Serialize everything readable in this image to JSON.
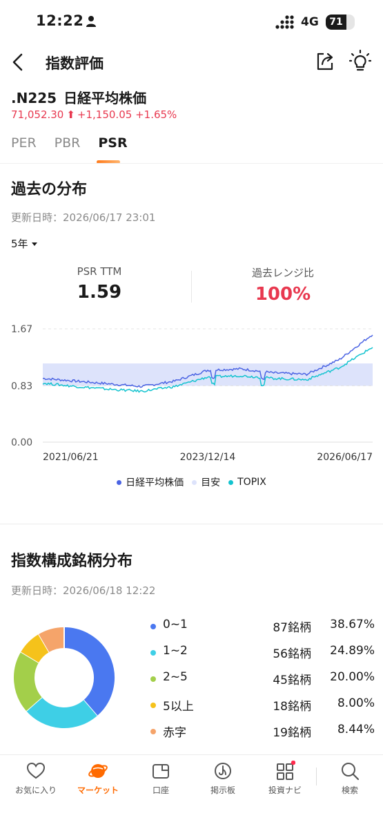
{
  "status_bar": {
    "time": "12:22",
    "network": "4G",
    "battery": "71",
    "battery_level": 0.71
  },
  "header": {
    "title": "指数評価"
  },
  "ticker": {
    "code": ".N225",
    "name": "日経平均株価",
    "price": "71,052.30",
    "change": "+1,150.05",
    "change_pct": "+1.65%",
    "color_up": "#e8384f"
  },
  "tabs": [
    {
      "label": "PER",
      "active": false
    },
    {
      "label": "PBR",
      "active": false
    },
    {
      "label": "PSR",
      "active": true
    }
  ],
  "history": {
    "title": "過去の分布",
    "updated": "更新日時：2026/06/17 23:01",
    "period": "5年",
    "kpi_left": {
      "label": "PSR TTM",
      "value": "1.59"
    },
    "kpi_right": {
      "label": "過去レンジ比",
      "value": "100%",
      "color": "#e8384f"
    }
  },
  "chart_data": {
    "type": "line",
    "x_ticks": [
      "2021/06/21",
      "2023/12/14",
      "2026/06/17"
    ],
    "y_ticks": [
      "1.67",
      "0.83",
      "0.00"
    ],
    "ylim": [
      0,
      1.67
    ],
    "band": [
      0.83,
      1.16
    ],
    "x": [
      "2021/06",
      "2021/12",
      "2022/06",
      "2022/12",
      "2023/06",
      "2023/12",
      "2024/06",
      "2024/12",
      "2025/06",
      "2025/12",
      "2026/06"
    ],
    "series": [
      {
        "name": "日経平均株価",
        "color": "#4a63e3",
        "values": [
          0.94,
          0.9,
          0.86,
          0.82,
          0.9,
          1.06,
          1.08,
          1.02,
          1.0,
          1.22,
          1.59
        ]
      },
      {
        "name": "TOPIX",
        "color": "#12c3cf",
        "values": [
          0.87,
          0.82,
          0.78,
          0.75,
          0.82,
          0.96,
          0.98,
          0.94,
          0.92,
          1.1,
          1.4
        ]
      }
    ],
    "legend": [
      {
        "name": "日経平均株価",
        "color": "#4a63e3"
      },
      {
        "name": "目安",
        "color": "#dde3fb"
      },
      {
        "name": "TOPIX",
        "color": "#12c3cf"
      }
    ],
    "legend_position": "bottom",
    "grid": true
  },
  "constituents": {
    "title": "指数構成銘柄分布",
    "updated": "更新日時：2026/06/18 12:22",
    "rows": [
      {
        "label": "0~1",
        "count": "87銘柄",
        "pct": "38.67%",
        "value": 38.67,
        "color": "#4a78f0"
      },
      {
        "label": "1~2",
        "count": "56銘柄",
        "pct": "24.89%",
        "value": 24.89,
        "color": "#3ecfe6"
      },
      {
        "label": "2~5",
        "count": "45銘柄",
        "pct": "20.00%",
        "value": 20.0,
        "color": "#a3cf4a"
      },
      {
        "label": "5以上",
        "count": "18銘柄",
        "pct": "8.00%",
        "value": 8.0,
        "color": "#f5c21b"
      },
      {
        "label": "赤字",
        "count": "19銘柄",
        "pct": "8.44%",
        "value": 8.44,
        "color": "#f5a46a"
      }
    ]
  },
  "nav": [
    {
      "label": "お気に入り",
      "icon": "heart-icon",
      "active": false
    },
    {
      "label": "マーケット",
      "icon": "planet-icon",
      "active": true
    },
    {
      "label": "口座",
      "icon": "wallet-icon",
      "active": false
    },
    {
      "label": "掲示板",
      "icon": "board-icon",
      "active": false
    },
    {
      "label": "投資ナビ",
      "icon": "grid-icon",
      "active": false,
      "badge": true
    },
    {
      "label": "検索",
      "icon": "search-icon",
      "active": false
    }
  ],
  "colors": {
    "accent": "#ff6a00",
    "up": "#e8384f",
    "badge": "#ff2a4d"
  }
}
